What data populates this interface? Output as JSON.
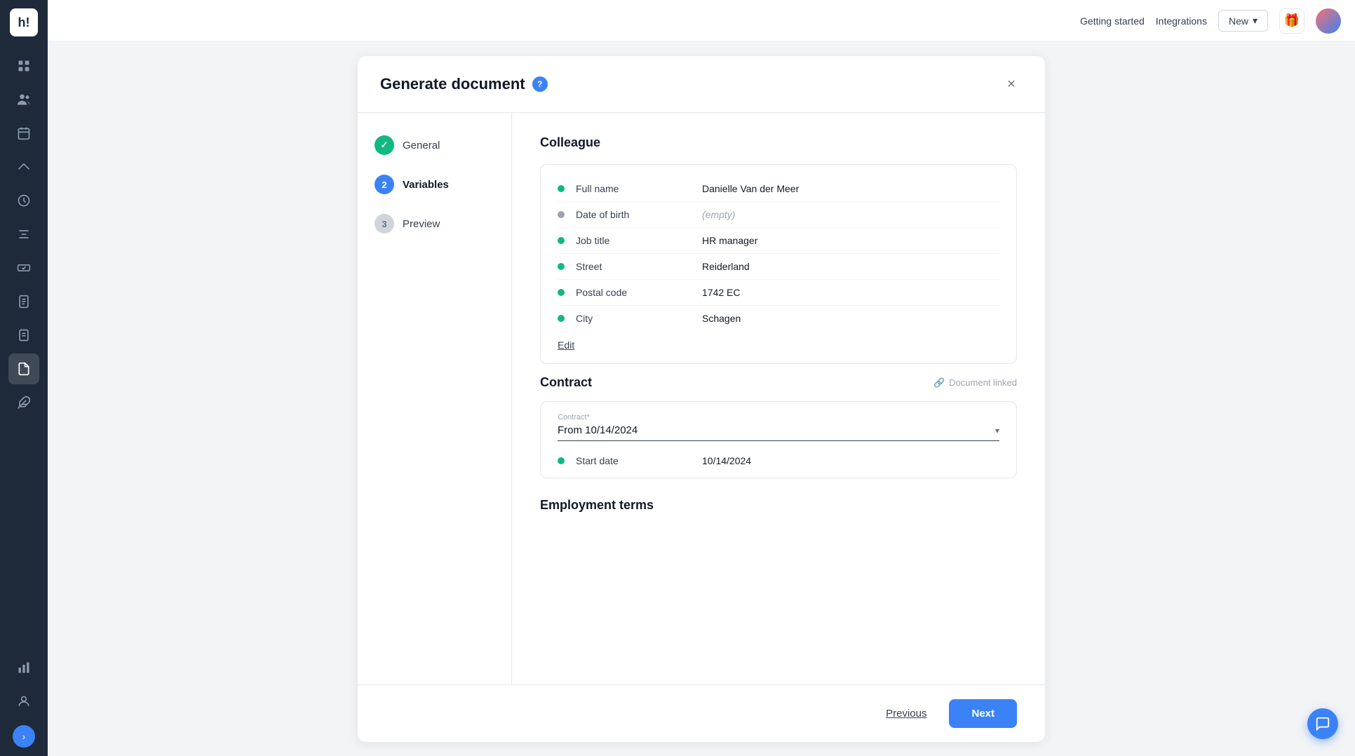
{
  "sidebar": {
    "logo": "h!",
    "items": [
      {
        "id": "dashboard",
        "icon": "grid",
        "active": false
      },
      {
        "id": "people",
        "icon": "users",
        "active": false
      },
      {
        "id": "calendar",
        "icon": "calendar",
        "active": false
      },
      {
        "id": "travel",
        "icon": "plane",
        "active": false
      },
      {
        "id": "time",
        "icon": "clock",
        "active": false
      },
      {
        "id": "tools",
        "icon": "tools",
        "active": false
      },
      {
        "id": "handshake",
        "icon": "handshake",
        "active": false
      },
      {
        "id": "reports",
        "icon": "file-text",
        "active": false
      },
      {
        "id": "tasks",
        "icon": "clipboard",
        "active": false
      },
      {
        "id": "documents",
        "icon": "doc",
        "active": true
      },
      {
        "id": "integrations2",
        "icon": "puzzle",
        "active": false
      },
      {
        "id": "analytics",
        "icon": "bar-chart",
        "active": false
      },
      {
        "id": "user",
        "icon": "user",
        "active": false
      }
    ],
    "expand_label": ">"
  },
  "topnav": {
    "getting_started": "Getting started",
    "integrations": "Integrations",
    "new_label": "New"
  },
  "modal": {
    "title": "Generate document",
    "help_icon": "?",
    "close_icon": "×",
    "steps": [
      {
        "number": "✓",
        "label": "General",
        "state": "completed"
      },
      {
        "number": "2",
        "label": "Variables",
        "state": "active"
      },
      {
        "number": "3",
        "label": "Preview",
        "state": "inactive"
      }
    ],
    "colleague_section": {
      "title": "Colleague",
      "fields": [
        {
          "label": "Full name",
          "value": "Danielle Van der Meer",
          "dot": "green",
          "empty": false
        },
        {
          "label": "Date of birth",
          "value": "(empty)",
          "dot": "gray",
          "empty": true
        },
        {
          "label": "Job title",
          "value": "HR manager",
          "dot": "green",
          "empty": false
        },
        {
          "label": "Street",
          "value": "Reiderland",
          "dot": "green",
          "empty": false
        },
        {
          "label": "Postal code",
          "value": "1742 EC",
          "dot": "green",
          "empty": false
        },
        {
          "label": "City",
          "value": "Schagen",
          "dot": "green",
          "empty": false
        }
      ],
      "edit_label": "Edit"
    },
    "contract_section": {
      "title": "Contract",
      "document_linked_label": "Document linked",
      "contract_label": "Contract*",
      "contract_value": "From 10/14/2024",
      "fields": [
        {
          "label": "Start date",
          "value": "10/14/2024",
          "dot": "green"
        }
      ]
    },
    "employment_section": {
      "title": "Employment terms"
    },
    "footer": {
      "previous_label": "Previous",
      "next_label": "Next"
    }
  }
}
